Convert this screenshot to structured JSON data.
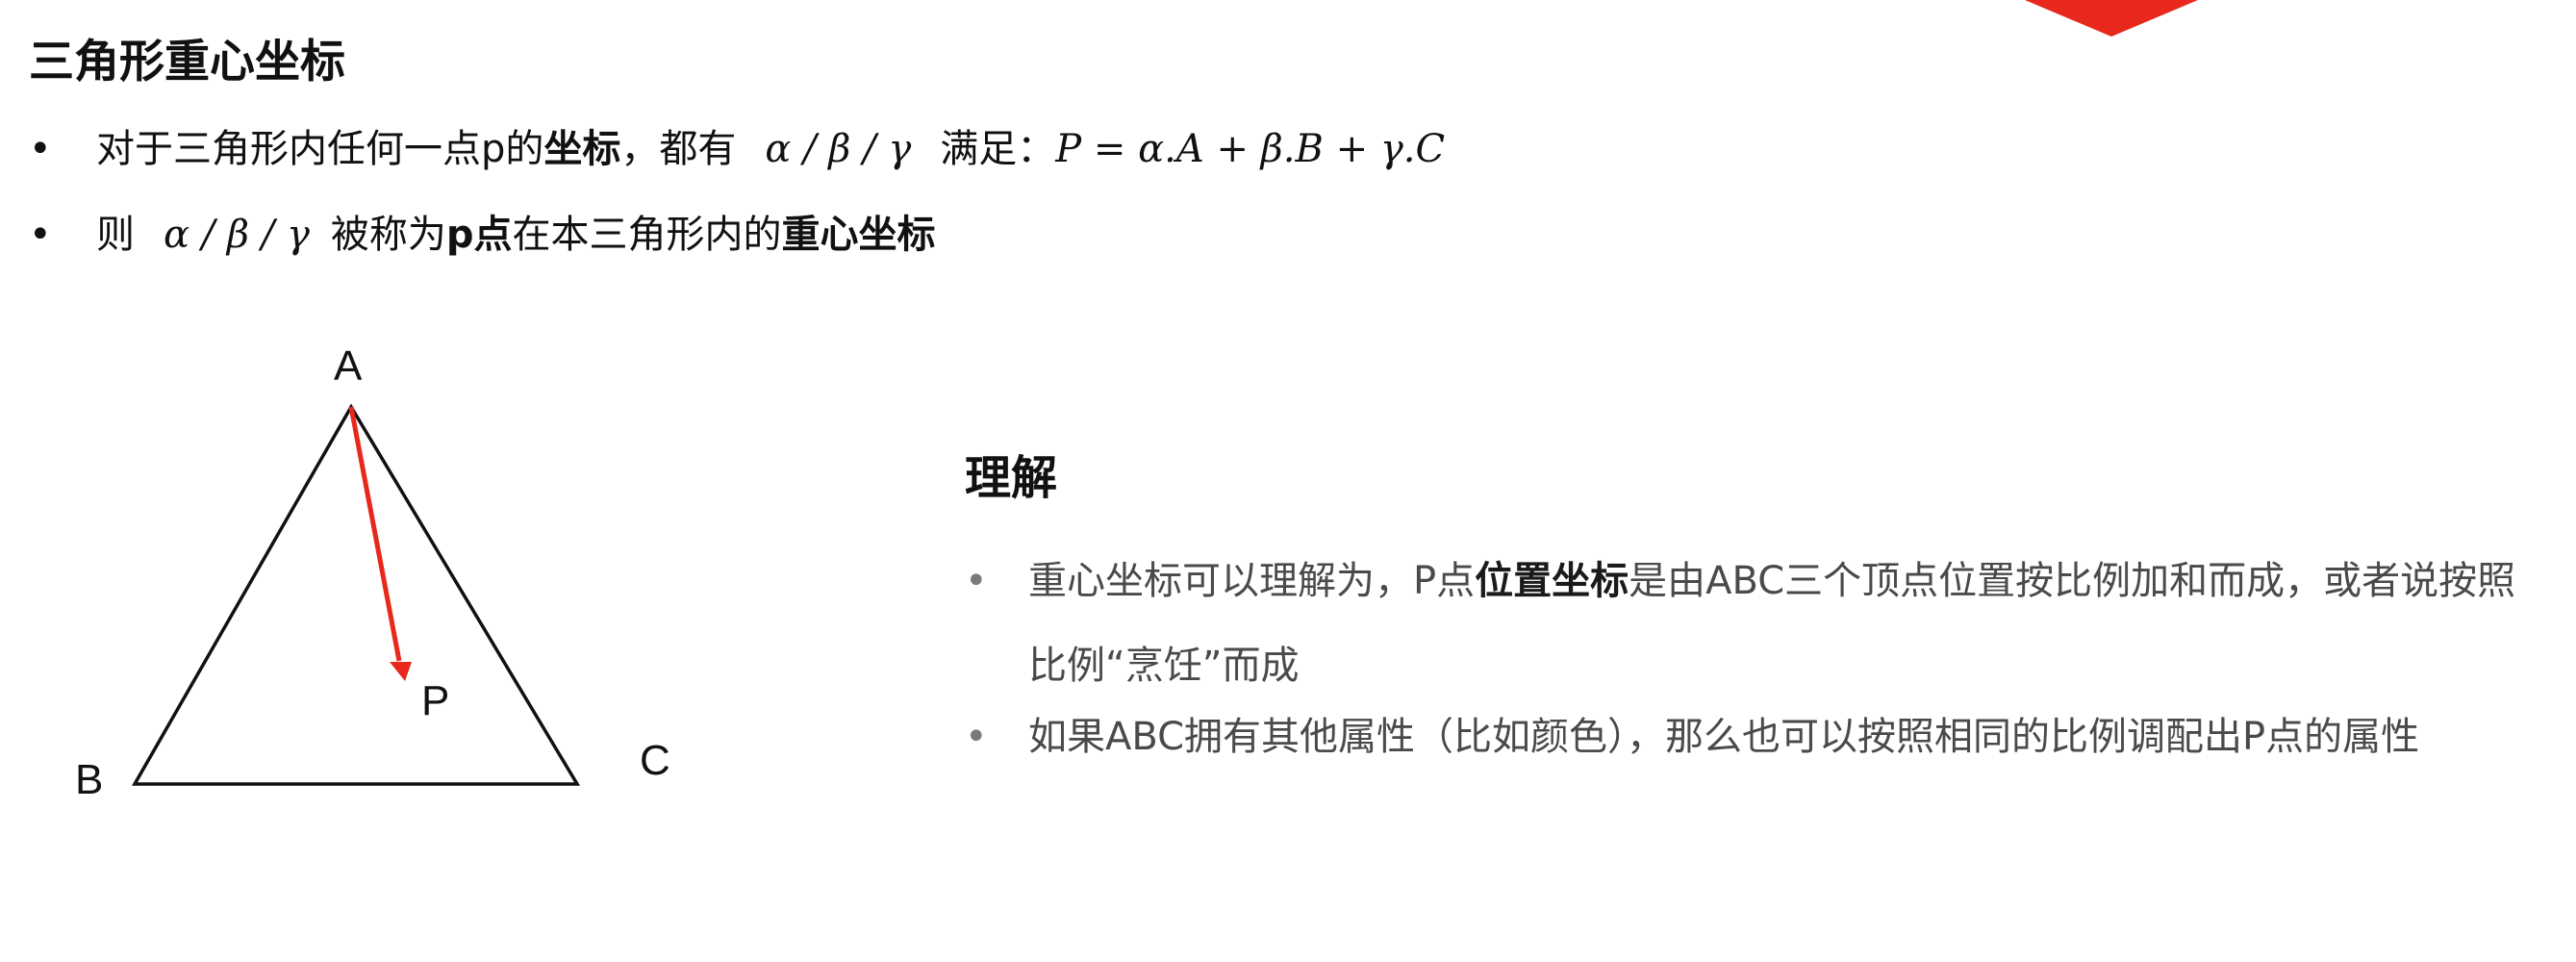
{
  "title": "三角形重心坐标",
  "bullets": [
    {
      "dot": "•",
      "text_a": "对于三角形内任何一点p的",
      "bold_a": "坐标",
      "text_b": "，都有",
      "math_a": "α / β / γ",
      "text_c": "满足：",
      "math_b": "P = α.A + β.B + γ.C"
    },
    {
      "dot": "•",
      "text_a": "则",
      "math_a": "α / β / γ",
      "text_b": "被称为",
      "bold_a": "p点",
      "text_c": "在本三角形内的",
      "bold_b": "重心坐标"
    }
  ],
  "diagram": {
    "labels": {
      "a": "A",
      "b": "B",
      "c": "C",
      "p": "P"
    },
    "colors": {
      "triangle": "#111111",
      "arrow": "#e8281c"
    }
  },
  "understanding": {
    "heading": "理解",
    "items": [
      {
        "dot": "•",
        "text_a": "重心坐标可以理解为，P点",
        "bold_a": "位置坐标",
        "text_b": "是由ABC三个顶点位置按比例加和而成，或者说按照比例“烹饪”而成"
      },
      {
        "dot": "•",
        "text_a": "如果ABC拥有其他属性（比如颜色），那么也可以按照相同的比例调配出P点的属性"
      }
    ]
  },
  "accent_color": "#e8281c"
}
